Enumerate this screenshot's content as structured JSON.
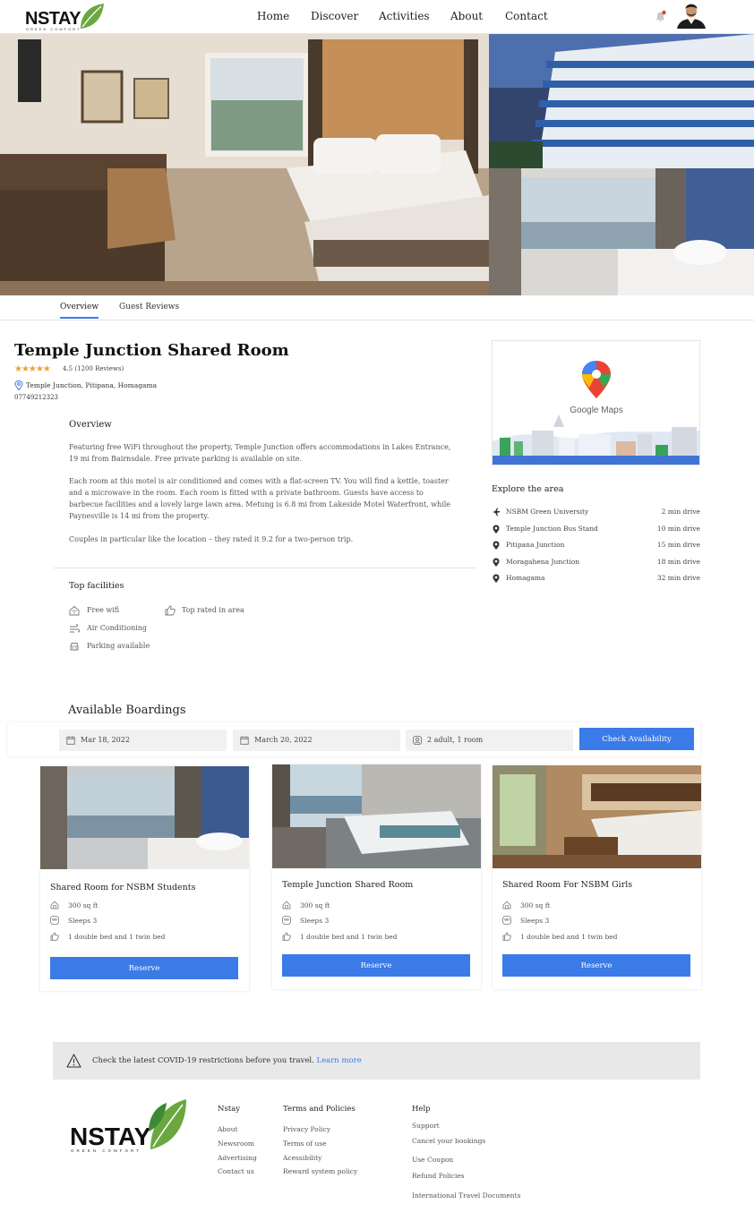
{
  "brand": {
    "name": "NSTAY",
    "tagline": "GREEN COMFORT",
    "leaf_color": "#6aa83f"
  },
  "nav": {
    "items": [
      "Home",
      "Discover",
      "Activities",
      "About",
      "Contact"
    ]
  },
  "tabs": [
    "Overview",
    "Guest Reviews"
  ],
  "property": {
    "title": "Temple Junction Shared Room",
    "rating_text": "4.5 (1200 Reviews)",
    "stars": "★★★★★",
    "location": "Temple Junction, Pitipana, Homagama",
    "phone": "07749212323"
  },
  "overview": {
    "heading": "Overview",
    "paragraphs": [
      "Featuring free WiFi throughout the property, Temple Junction  offers accommodations in Lakes Entrance, 19 mi from Bairnsdale. Free private parking is available on site.",
      "Each room at this motel is air conditioned and comes with a flat-screen TV. You will find a kettle, toaster and a microwave in the room. Each room is fitted with a private bathroom. Guests have access to barbecue facilities and a lovely large lawn area. Metung is 6.8 mi from Lakeside Motel Waterfront, while Paynesville is 14 mi from the property.",
      "Couples in particular like the location – they rated it 9.2 for a two-person trip."
    ]
  },
  "facilities": {
    "heading": "Top facilities",
    "items": [
      {
        "label": "Free wifi",
        "icon": "wifi-icon"
      },
      {
        "label": "Top rated in area",
        "icon": "thumbs-up-icon"
      },
      {
        "label": "Air Conditioning",
        "icon": "air-conditioning-icon"
      },
      {
        "label": "Parking available",
        "icon": "car-icon"
      }
    ]
  },
  "map": {
    "label": "Google Maps"
  },
  "explore": {
    "heading": "Explore the area",
    "items": [
      {
        "name": "NSBM Green University",
        "distance": "2 min drive",
        "icon": "plane-icon"
      },
      {
        "name": "Temple Junction Bus Stand",
        "distance": "10 min drive",
        "icon": "map-pin-icon"
      },
      {
        "name": "Pitipana Junction",
        "distance": "15 min drive",
        "icon": "map-pin-icon"
      },
      {
        "name": "Moragahena Junction",
        "distance": "18 min drive",
        "icon": "map-pin-icon"
      },
      {
        "name": "Homagama",
        "distance": "32 min drive",
        "icon": "map-pin-icon"
      }
    ]
  },
  "availability": {
    "heading": "Available Boardings",
    "checkin": "Mar 18, 2022",
    "checkout": "March 20, 2022",
    "guests": "2 adult, 1 room",
    "button": "Check Availability"
  },
  "rooms": [
    {
      "name": "Shared Room for NSBM Students",
      "size": "300 sq ft",
      "sleeps": "Sleeps 3",
      "beds": "1 double bed and 1 twin bed",
      "button": "Reserve"
    },
    {
      "name": "Temple Junction Shared Room",
      "size": "300 sq ft",
      "sleeps": "Sleeps 3",
      "beds": "1 double bed and 1 twin bed",
      "button": "Reserve"
    },
    {
      "name": "Shared Room For NSBM Girls",
      "size": "300 sq ft",
      "sleeps": "Sleeps 3",
      "beds": "1 double bed and 1 twin bed",
      "button": "Reserve"
    }
  ],
  "covid": {
    "text": "Check the latest COVID-19 restrictions before you travel.",
    "link": "Learn more"
  },
  "footer": {
    "nstay": {
      "heading": "Nstay",
      "links": [
        "About",
        "Newsroom",
        "Advertising",
        "Contact us"
      ]
    },
    "terms": {
      "heading": "Terms and Policies",
      "links": [
        "Privacy Policy",
        "Terms of use",
        "Acessibility",
        "Reward system policy"
      ]
    },
    "help": {
      "heading": "Help",
      "links": [
        "Support",
        "Cancel your bookings",
        "Use Coupon",
        "Refund Policies",
        "International Travel Documents"
      ]
    }
  },
  "colors": {
    "accent": "#3b7be8",
    "star": "#e8a23c",
    "covid_bg": "#e8e8e8"
  }
}
